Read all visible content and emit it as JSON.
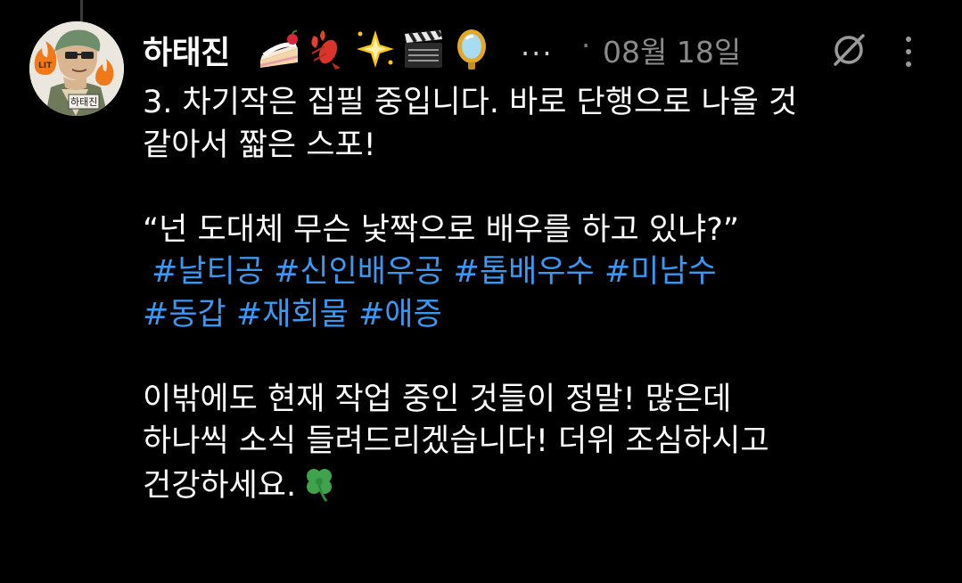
{
  "post": {
    "author": "하태진",
    "avatar_badge_text": "하태진",
    "emoji_icons": [
      "cake-icon",
      "lobster-icon",
      "sparkle-star-icon",
      "clapper-board-icon",
      "mirror-icon"
    ],
    "more_emoji": "...",
    "separator": "·",
    "date": "08월 18일",
    "line1": "3. 차기작은 집필 중입니다. 바로 단행으로 나올 것",
    "line2": "같아서 짧은 스포!",
    "quote": "“넌 도대체 무슨 낯짝으로 배우를 하고 있냐?”",
    "hashtags_row1": [
      "#날티공",
      "#신인배우공",
      "#톱배우수",
      "#미남수"
    ],
    "hashtags_row2": [
      "#동갑",
      "#재회물",
      "#애증"
    ],
    "line6": "이밖에도 현재 작업 중인 것들이 정말! 많은데",
    "line7": "하나씩 소식 들려드리겠습니다! 더위 조심하시고",
    "line8": "건강하세요.",
    "end_icon": "four-leaf-clover-icon"
  },
  "colors": {
    "background": "#000000",
    "text": "#ffffff",
    "hashtag": "#3b97f0",
    "meta": "#8a8a8a"
  }
}
